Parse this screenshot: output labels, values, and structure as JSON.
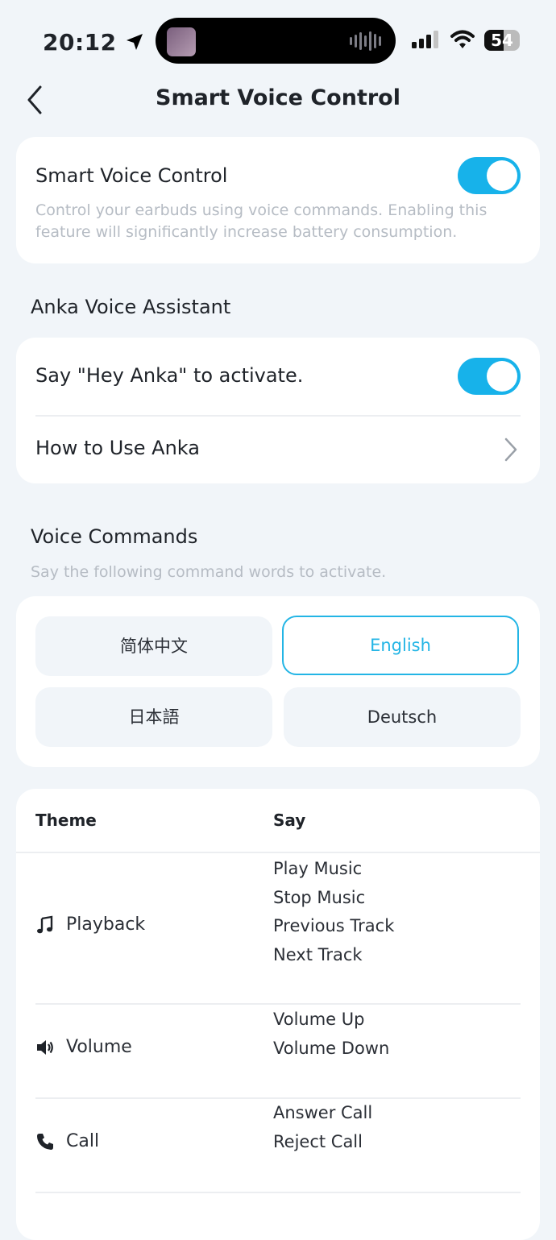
{
  "status_bar": {
    "time": "20:12",
    "battery": "54"
  },
  "nav": {
    "title": "Smart Voice Control"
  },
  "smart_voice": {
    "title": "Smart Voice Control",
    "description_line1": "Control your earbuds using voice commands. Enabling this",
    "description_line2": "feature will significantly increase battery consumption.",
    "enabled": true
  },
  "assistant": {
    "section_title": "Anka Voice Assistant",
    "hey_label": "Say \"Hey Anka\" to activate.",
    "hey_enabled": true,
    "howto_label": "How to Use Anka"
  },
  "commands": {
    "section_title": "Voice Commands",
    "subtitle": "Say the following command words to activate.",
    "languages": [
      {
        "label": "简体中文",
        "selected": false
      },
      {
        "label": "English",
        "selected": true
      },
      {
        "label": "日本語",
        "selected": false
      },
      {
        "label": "Deutsch",
        "selected": false
      }
    ],
    "table": {
      "col_theme": "Theme",
      "col_say": "Say",
      "rows": [
        {
          "icon": "music-note-icon",
          "theme": "Playback",
          "say": [
            "Play Music",
            "Stop Music",
            "Previous Track",
            "Next Track"
          ]
        },
        {
          "icon": "speaker-icon",
          "theme": "Volume",
          "say": [
            "Volume Up",
            "Volume Down"
          ]
        },
        {
          "icon": "phone-icon",
          "theme": "Call",
          "say": [
            "Answer Call",
            "Reject Call"
          ]
        }
      ]
    }
  },
  "colors": {
    "accent": "#17b2ea",
    "background": "#f1f5f9"
  }
}
